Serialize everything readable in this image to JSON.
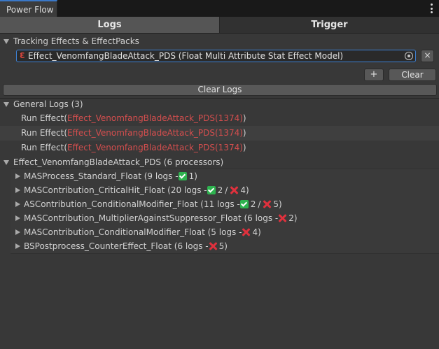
{
  "window": {
    "tab_title": "Power Flow"
  },
  "tabs": [
    {
      "label": "Logs",
      "active": true
    },
    {
      "label": "Trigger",
      "active": false
    }
  ],
  "tracking": {
    "header": "Tracking Effects & EffectPacks",
    "field_value": "Effect_VenomfangBladeAttack_PDS (Float Multi Attribute Stat Effect Model)",
    "remove_label": "×",
    "add_label": "+",
    "clear_label": "Clear"
  },
  "clear_logs_label": "Clear Logs",
  "general_logs": {
    "header": "General Logs (3)",
    "entries": [
      {
        "prefix": "Run Effect(",
        "name": "Effect_VenomfangBladeAttack_PDS(1374)",
        "suffix": ")"
      },
      {
        "prefix": "Run Effect(",
        "name": "Effect_VenomfangBladeAttack_PDS(1374)",
        "suffix": ")"
      },
      {
        "prefix": "Run Effect(",
        "name": "Effect_VenomfangBladeAttack_PDS(1374)",
        "suffix": ")"
      }
    ]
  },
  "effect_group": {
    "header": "Effect_VenomfangBladeAttack_PDS (6 processors)",
    "processors": [
      {
        "label": "MASProcess_Standard_Float (9 logs - ",
        "ok": "1",
        "fail": null,
        "end": ")"
      },
      {
        "label": "MASContribution_CriticalHit_Float (20 logs - ",
        "ok": "2",
        "fail": "4",
        "end": ")"
      },
      {
        "label": "ASContribution_ConditionalModifier_Float (11 logs - ",
        "ok": "2",
        "fail": "5",
        "end": ")"
      },
      {
        "label": "MASContribution_MultiplierAgainstSuppressor_Float (6 logs - ",
        "ok": null,
        "fail": "2",
        "end": ")"
      },
      {
        "label": "MASContribution_ConditionalModifier_Float (5 logs - ",
        "ok": null,
        "fail": "4",
        "end": ")"
      },
      {
        "label": "BSPostprocess_CounterEffect_Float (6 logs - ",
        "ok": null,
        "fail": "5",
        "end": ")"
      }
    ],
    "slash": "/"
  },
  "colors": {
    "accent": "#3d82d6",
    "error_text": "#d44e4e",
    "success": "#2eb34f",
    "failure": "#e0313d"
  }
}
